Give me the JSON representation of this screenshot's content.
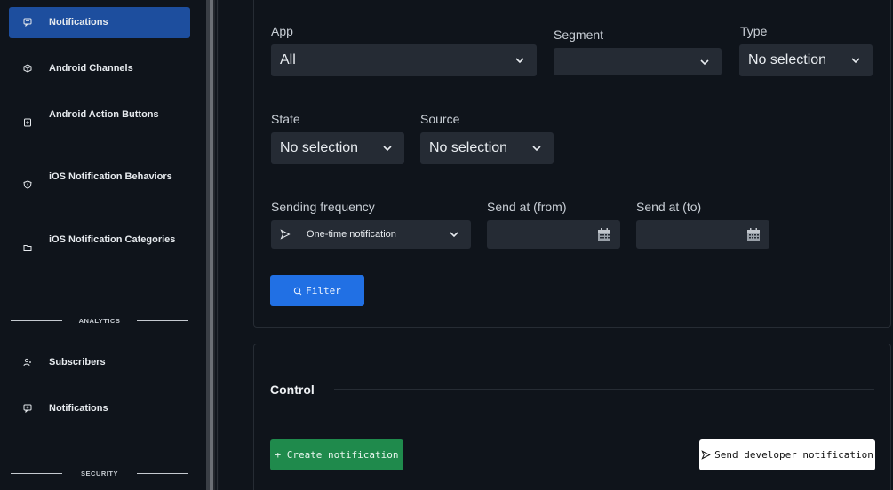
{
  "sidebar": {
    "items": [
      {
        "label": "Notifications",
        "icon": "chat-icon",
        "active": true
      },
      {
        "label": "Android Channels",
        "icon": "cube-icon"
      },
      {
        "label": "Android Action Buttons",
        "icon": "action-button-icon"
      },
      {
        "label": "iOS Notification Behaviors",
        "icon": "shield-icon"
      },
      {
        "label": "iOS Notification Categories",
        "icon": "folder-icon"
      }
    ],
    "analytics_header": "ANALYTICS",
    "analytics_items": [
      {
        "label": "Subscribers",
        "icon": "users-icon"
      },
      {
        "label": "Notifications",
        "icon": "chat-plus-icon"
      }
    ],
    "security_header": "SECURITY"
  },
  "filters": {
    "app": {
      "label": "App",
      "value": "All"
    },
    "segment": {
      "label": "Segment",
      "value": ""
    },
    "type": {
      "label": "Type",
      "value": "No selection"
    },
    "state": {
      "label": "State",
      "value": "No selection"
    },
    "source": {
      "label": "Source",
      "value": "No selection"
    },
    "frequency": {
      "label": "Sending frequency",
      "value": "One-time notification"
    },
    "send_from": {
      "label": "Send at (from)",
      "value": ""
    },
    "send_to": {
      "label": "Send at (to)",
      "value": ""
    },
    "filter_button": "Filter"
  },
  "control": {
    "title": "Control",
    "create_button": "+ Create notification",
    "dev_button": "Send developer notification"
  },
  "colors": {
    "accent": "#2170e4",
    "active_nav": "#1d4e9e",
    "success": "#1f8a4c"
  }
}
